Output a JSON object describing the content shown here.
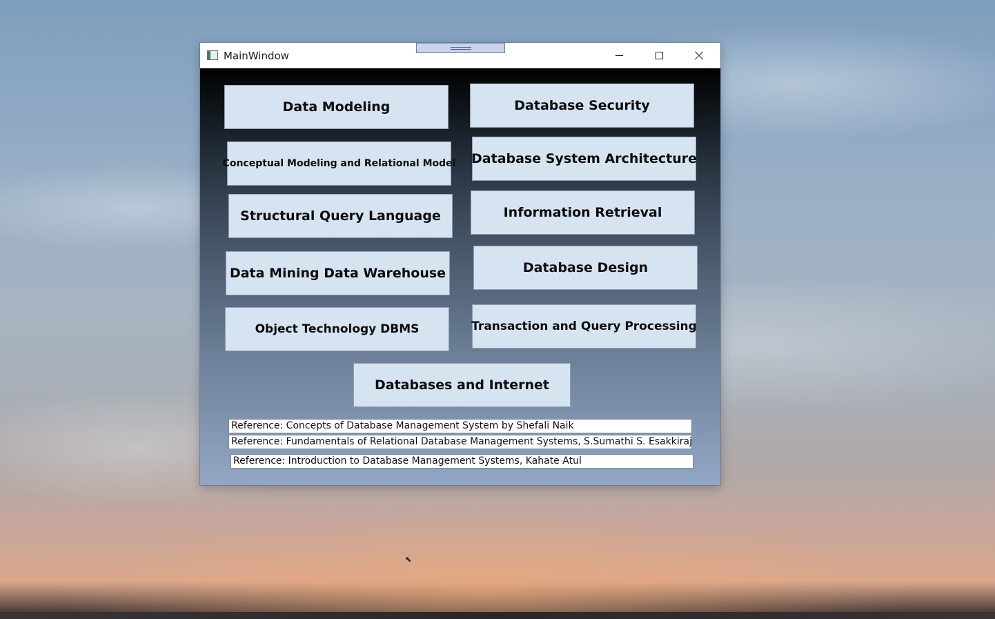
{
  "window": {
    "title": "MainWindow"
  },
  "buttons": {
    "data_modeling": "Data Modeling",
    "database_security": "Database Security",
    "conceptual_modeling": "Conceptual Modeling and Relational Model",
    "database_system_architecture": "Database System Architecture",
    "structural_query_language": "Structural Query Language",
    "information_retrieval": "Information Retrieval",
    "data_mining": "Data Mining Data Warehouse",
    "database_design": "Database Design",
    "object_technology": "Object Technology DBMS",
    "transaction_processing": "Transaction and Query Processing",
    "databases_internet": "Databases and Internet"
  },
  "references": [
    "Reference: Concepts of Database Management System by Shefali Naik",
    "Reference: Fundamentals of Relational Database Management Systems, S.Sumathi S. Esakkirajan",
    "Reference: Introduction to Database Management Systems, Kahate Atul"
  ],
  "icons": {
    "app": "app-window-icon",
    "minimize": "minimize-icon",
    "maximize": "maximize-icon",
    "close": "close-icon"
  }
}
